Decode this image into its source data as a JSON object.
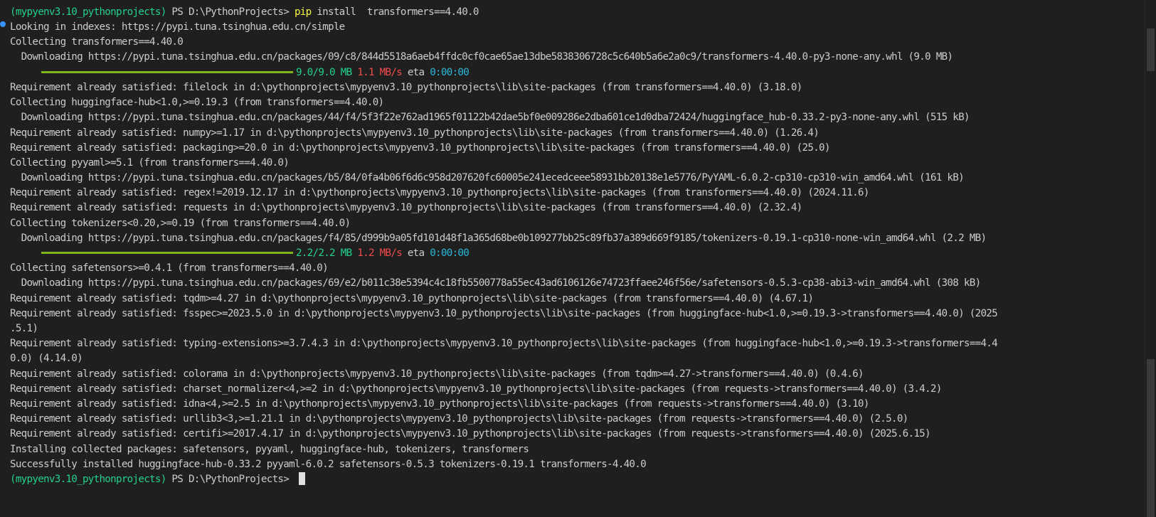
{
  "terminal": {
    "prompt_env": "(mypyenv3.10_pythonprojects)",
    "prompt_path": " PS D:\\PythonProjects> ",
    "command_name": "pip",
    "command_args": " install  transformers==4.40.0",
    "lines": [
      "Looking in indexes: https://pypi.tuna.tsinghua.edu.cn/simple",
      "Collecting transformers==4.40.0",
      "  Downloading https://pypi.tuna.tsinghua.edu.cn/packages/09/c8/844d5518a6aeb4ffdc0cf0cae65ae13dbe5838306728c5c640b5a6e2a0c9/transformers-4.40.0-py3-none-any.whl (9.0 MB)",
      "Requirement already satisfied: filelock in d:\\pythonprojects\\mypyenv3.10_pythonprojects\\lib\\site-packages (from transformers==4.40.0) (3.18.0)",
      "Collecting huggingface-hub<1.0,>=0.19.3 (from transformers==4.40.0)",
      "  Downloading https://pypi.tuna.tsinghua.edu.cn/packages/44/f4/5f3f22e762ad1965f01122b42dae5bf0e009286e2dba601ce1d0dba72424/huggingface_hub-0.33.2-py3-none-any.whl (515 kB)",
      "Requirement already satisfied: numpy>=1.17 in d:\\pythonprojects\\mypyenv3.10_pythonprojects\\lib\\site-packages (from transformers==4.40.0) (1.26.4)",
      "Requirement already satisfied: packaging>=20.0 in d:\\pythonprojects\\mypyenv3.10_pythonprojects\\lib\\site-packages (from transformers==4.40.0) (25.0)",
      "Collecting pyyaml>=5.1 (from transformers==4.40.0)",
      "  Downloading https://pypi.tuna.tsinghua.edu.cn/packages/b5/84/0fa4b06f6d6c958d207620fc60005e241ecedceee58931bb20138e1e5776/PyYAML-6.0.2-cp310-cp310-win_amd64.whl (161 kB)",
      "Requirement already satisfied: regex!=2019.12.17 in d:\\pythonprojects\\mypyenv3.10_pythonprojects\\lib\\site-packages (from transformers==4.40.0) (2024.11.6)",
      "Requirement already satisfied: requests in d:\\pythonprojects\\mypyenv3.10_pythonprojects\\lib\\site-packages (from transformers==4.40.0) (2.32.4)",
      "Collecting tokenizers<0.20,>=0.19 (from transformers==4.40.0)",
      "  Downloading https://pypi.tuna.tsinghua.edu.cn/packages/f4/85/d999b9a05fd101d48f1a365d68be0b109277bb25c89fb37a389d669f9185/tokenizers-0.19.1-cp310-none-win_amd64.whl (2.2 MB)",
      "Collecting safetensors>=0.4.1 (from transformers==4.40.0)",
      "  Downloading https://pypi.tuna.tsinghua.edu.cn/packages/69/e2/b011c38e5394c4c18fb5500778a55ec43ad6106126e74723ffaee246f56e/safetensors-0.5.3-cp38-abi3-win_amd64.whl (308 kB)",
      "Requirement already satisfied: tqdm>=4.27 in d:\\pythonprojects\\mypyenv3.10_pythonprojects\\lib\\site-packages (from transformers==4.40.0) (4.67.1)",
      "Requirement already satisfied: fsspec>=2023.5.0 in d:\\pythonprojects\\mypyenv3.10_pythonprojects\\lib\\site-packages (from huggingface-hub<1.0,>=0.19.3->transformers==4.40.0) (2025",
      ".5.1)",
      "Requirement already satisfied: typing-extensions>=3.7.4.3 in d:\\pythonprojects\\mypyenv3.10_pythonprojects\\lib\\site-packages (from huggingface-hub<1.0,>=0.19.3->transformers==4.4",
      "0.0) (4.14.0)",
      "Requirement already satisfied: colorama in d:\\pythonprojects\\mypyenv3.10_pythonprojects\\lib\\site-packages (from tqdm>=4.27->transformers==4.40.0) (0.4.6)",
      "Requirement already satisfied: charset_normalizer<4,>=2 in d:\\pythonprojects\\mypyenv3.10_pythonprojects\\lib\\site-packages (from requests->transformers==4.40.0) (3.4.2)",
      "Requirement already satisfied: idna<4,>=2.5 in d:\\pythonprojects\\mypyenv3.10_pythonprojects\\lib\\site-packages (from requests->transformers==4.40.0) (3.10)",
      "Requirement already satisfied: urllib3<3,>=1.21.1 in d:\\pythonprojects\\mypyenv3.10_pythonprojects\\lib\\site-packages (from requests->transformers==4.40.0) (2.5.0)",
      "Requirement already satisfied: certifi>=2017.4.17 in d:\\pythonprojects\\mypyenv3.10_pythonprojects\\lib\\site-packages (from requests->transformers==4.40.0) (2025.6.15)",
      "Installing collected packages: safetensors, pyyaml, huggingface-hub, tokenizers, transformers",
      "Successfully installed huggingface-hub-0.33.2 pyyaml-6.0.2 safetensors-0.5.3 tokenizers-0.19.1 transformers-4.40.0"
    ],
    "progress": [
      {
        "size": "9.0/9.0 MB",
        "speed": "1.1 MB/s",
        "eta_label": "eta",
        "eta": "0:00:00",
        "fraction": 1.0
      },
      {
        "size": "2.2/2.2 MB",
        "speed": "1.2 MB/s",
        "eta_label": "eta",
        "eta": "0:00:00",
        "fraction": 1.0
      }
    ]
  },
  "colors": {
    "background": "#1f1f1f",
    "text": "#cccccc",
    "prompt_env": "#23d18b",
    "command": "#f5f543",
    "speed": "#f14c4c",
    "eta": "#29b8db",
    "progress_bar": "#7fb51b"
  }
}
